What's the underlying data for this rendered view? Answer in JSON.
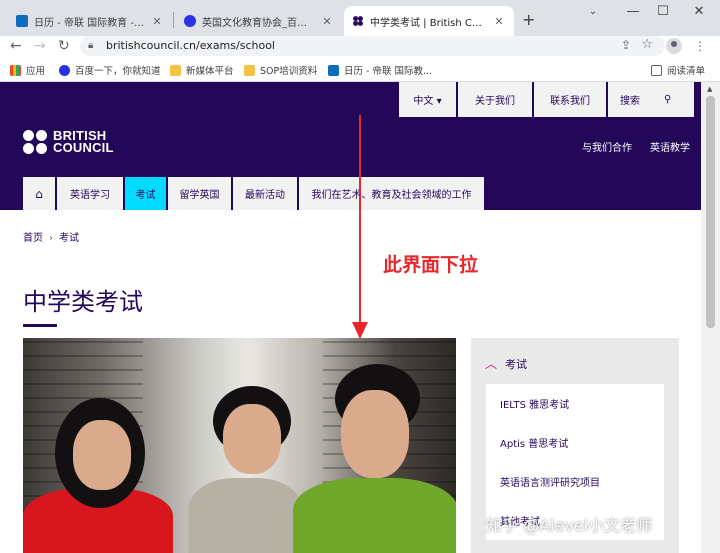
{
  "browser": {
    "tabs": [
      {
        "title": "日历 - 帝联 国际教育 - Outlook",
        "favicon_color": "#0f6cbd",
        "active": false
      },
      {
        "title": "英国文化教育协会_百度搜索",
        "favicon_color": "#2932e1",
        "active": false
      },
      {
        "title": "中学类考试 | British Council",
        "favicon_color": "#23085a",
        "active": true
      }
    ],
    "new_tab": "+",
    "window_controls": {
      "minimize": "—",
      "maximize": "☐",
      "close": "✕"
    },
    "url": "britishcouncil.cn/exams/school",
    "bookmarks": [
      {
        "label": "应用",
        "icon": "apps-grid-icon"
      },
      {
        "label": "百度一下，你就知道",
        "icon": "baidu-paw-icon"
      },
      {
        "label": "新媒体平台",
        "icon": "folder-icon"
      },
      {
        "label": "SOP培训资料",
        "icon": "folder-icon"
      },
      {
        "label": "日历 - 帝联 国际教...",
        "icon": "outlook-icon"
      }
    ],
    "reading_list": "阅读清单"
  },
  "site": {
    "brand_color": "#23085a",
    "accent_color": "#00dcff",
    "logo_line1": "BRITISH",
    "logo_line2": "COUNCIL",
    "utility": {
      "language": "中文 ▾",
      "about": "关于我们",
      "contact": "联系我们",
      "search": "搜索"
    },
    "hero_links": [
      "与我们合作",
      "英语教学"
    ],
    "nav": [
      "英语学习",
      "考试",
      "留学英国",
      "最新活动",
      "我们在艺术、教育及社会领域的工作"
    ],
    "breadcrumb": {
      "home": "首页",
      "current": "考试"
    },
    "page_title": "中学类考试",
    "sidebar": {
      "heading": "考试",
      "items": [
        "IELTS 雅思考试",
        "Aptis 普思考试",
        "英语语言测评研究项目",
        "其他考试"
      ]
    }
  },
  "annotation": {
    "text": "此界面下拉",
    "color": "#e8262b"
  },
  "watermark": "知乎 @Alevel小文老师"
}
